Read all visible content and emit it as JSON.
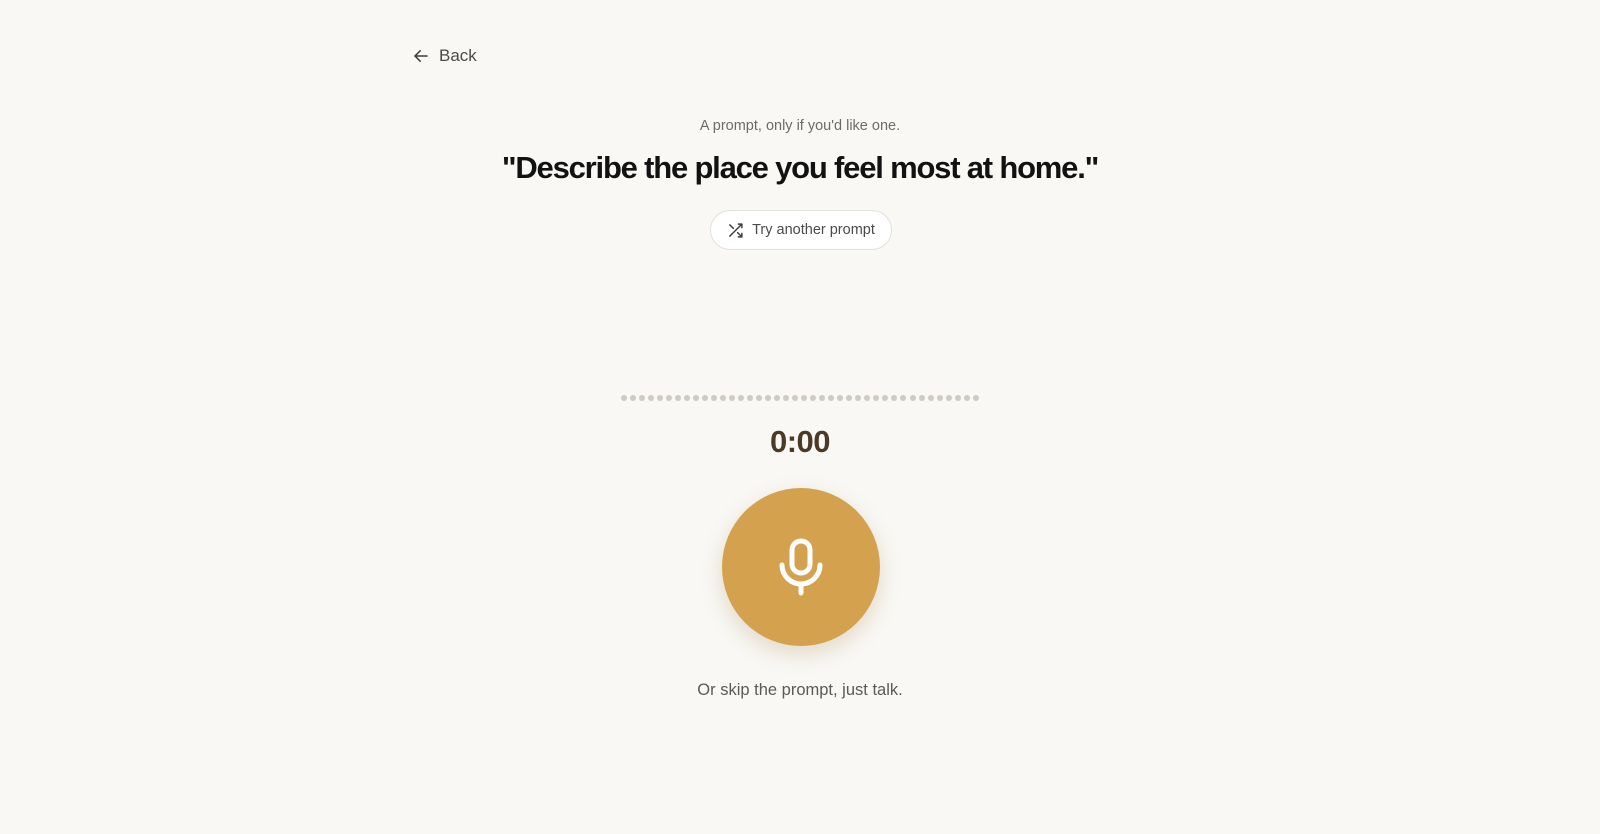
{
  "nav": {
    "back_label": "Back",
    "back_icon": "arrow-left-icon"
  },
  "prompt": {
    "caption": "A prompt, only if you'd like one.",
    "text": "\"Describe the place you feel most at home.\"",
    "shuffle_label": "Try another prompt",
    "shuffle_icon": "shuffle-icon"
  },
  "recorder": {
    "timer": "0:00",
    "record_icon": "microphone-icon",
    "waveform_dot_count": 40,
    "skip_hint": "Or skip the prompt, just talk."
  },
  "colors": {
    "background": "#f9f8f5",
    "accent": "#d4a24e",
    "timer_text": "#4a3a28",
    "waveform_dot": "#cfcbc2"
  }
}
